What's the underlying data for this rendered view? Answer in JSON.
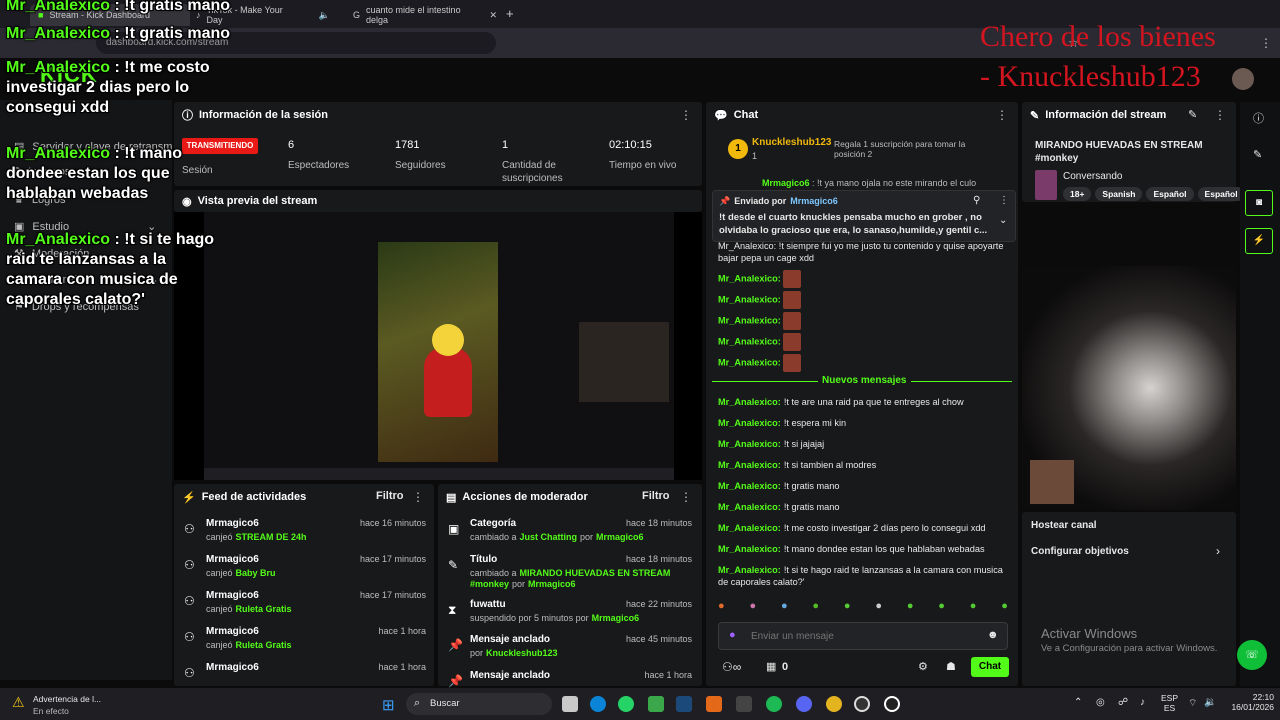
{
  "browser": {
    "tabs": [
      "Stream - Kick Dashboard",
      "TikTok - Make Your Day",
      "cuanto mide el intestino delga"
    ],
    "url": "dashboard.kick.com/stream",
    "new_tab": "+"
  },
  "brand": {
    "logo": "KICK",
    "accent": "#53fc18",
    "live_red": "#e91916"
  },
  "title_overlay": {
    "line1": "Chero de los bienes",
    "line2": "- Knuckleshub123"
  },
  "left_nav": {
    "items": [
      "Servidor y clave de retransm",
      "Ingresos",
      "Logros",
      "Estudio",
      "Moderación",
      "Comunidad",
      "Drops y recompensas"
    ]
  },
  "session": {
    "title": "Información de la sesión",
    "badge": "TRANSMITIENDO",
    "badge_sub": "Sesión",
    "stats": [
      {
        "value": "6",
        "label": "Espectadores"
      },
      {
        "value": "1781",
        "label": "Seguidores"
      },
      {
        "value": "1",
        "label": "Cantidad de suscripciones"
      },
      {
        "value": "02:10:15",
        "label": "Tiempo en vivo"
      }
    ]
  },
  "preview": {
    "title": "Vista previa del stream"
  },
  "feed": {
    "title": "Feed de actividades",
    "filter": "Filtro",
    "rows": [
      {
        "user": "Mrmagico6",
        "action": "canjeó",
        "item": "STREAM DE 24h",
        "time": "hace 16 minutos"
      },
      {
        "user": "Mrmagico6",
        "action": "canjeó",
        "item": "Baby Bru",
        "time": "hace 17 minutos"
      },
      {
        "user": "Mrmagico6",
        "action": "canjeó",
        "item": "Ruleta Gratis",
        "time": "hace 17 minutos"
      },
      {
        "user": "Mrmagico6",
        "action": "canjeó",
        "item": "Ruleta Gratis",
        "time": "hace 1 hora"
      },
      {
        "user": "Mrmagico6",
        "action": "",
        "item": "",
        "time": "hace 1 hora"
      }
    ]
  },
  "mod": {
    "title": "Acciones de moderador",
    "filter": "Filtro",
    "rows": [
      {
        "head": "Categoría",
        "l1": "cambiado a",
        "v1": "Just Chatting",
        "l2": "por",
        "v2": "Mrmagico6",
        "time": "hace 18 minutos"
      },
      {
        "head": "Título",
        "l1": "cambiado a",
        "v1": "MIRANDO HUEVADAS EN STREAM #monkey",
        "l2": "por",
        "v2": "Mrmagico6",
        "time": "hace 18 minutos"
      },
      {
        "head": "fuwattu",
        "l1": "suspendido por 5 minutos por",
        "v1": "Mrmagico6",
        "l2": "",
        "v2": "",
        "time": "hace 22 minutos"
      },
      {
        "head": "Mensaje anclado",
        "l1": "por",
        "v1": "Knuckleshub123",
        "l2": "",
        "v2": "",
        "time": "hace 45 minutos"
      },
      {
        "head": "Mensaje anclado",
        "l1": "",
        "v1": "",
        "l2": "",
        "v2": "",
        "time": "hace 1 hora"
      }
    ]
  },
  "chat": {
    "title": "Chat",
    "top_user": "Knuckleshub123",
    "top_rank": "1",
    "top_count": "1",
    "gift_text": "Regala 1 suscripción para tomar la posición 2",
    "pinned_label": "Enviado por",
    "pinned_user": "Mrmagico6",
    "pinned_text": "!t desde el cuarto knuckles pensaba mucho en grober , no olvidaba lo gracioso que era, lo sanaso,humilde,y gentil c...",
    "partial_user": "Mrmagico6",
    "partial_text": ": !t ya mano ojala no este mirando el culo",
    "partial2_text": "Mr_Analexico: !t siempre fui yo me justo tu contenido y quise apoyarte bajar pepa un cage xdd",
    "emote_user": "Mr_Analexico:",
    "new_messages": "Nuevos mensajes",
    "messages": [
      {
        "user": "Mr_Analexico:",
        "text": "!t te are una raid pa que te entreges al chow"
      },
      {
        "user": "Mr_Analexico:",
        "text": "!t espera mi kin"
      },
      {
        "user": "Mr_Analexico:",
        "text": "!t si jajajaj"
      },
      {
        "user": "Mr_Analexico:",
        "text": "!t si tambien al modres"
      },
      {
        "user": "Mr_Analexico:",
        "text": "!t gratis mano"
      },
      {
        "user": "Mr_Analexico:",
        "text": "!t gratis mano"
      },
      {
        "user": "Mr_Analexico:",
        "text": "!t me costo investigar 2 días pero lo consegui xdd"
      },
      {
        "user": "Mr_Analexico:",
        "text": "!t mano dondee estan los que hablaban webadas"
      },
      {
        "user": "Mr_Analexico:",
        "text": "!t si te hago raid te lanzansas a la camara con musica de caporales calato?'"
      }
    ],
    "input_placeholder": "Enviar un mensaje",
    "points": "0",
    "send": "Chat"
  },
  "stream_info": {
    "title": "Información del stream",
    "stream_title": "MIRANDO HUEVADAS EN STREAM #monkey",
    "category": "Conversando",
    "tags": [
      "18+",
      "Spanish",
      "Español",
      "Español"
    ]
  },
  "actions": {
    "host": "Hostear canal",
    "goals": "Configurar objetivos"
  },
  "watermark": {
    "line1": "Activar Windows",
    "line2": "Ve a Configuración para activar Windows."
  },
  "overlay_chat": [
    {
      "user": "Mr_Analexico",
      "text": " : !t gratis mano"
    },
    {
      "user": "Mr_Analexico",
      "text": " : !t gratis mano"
    },
    {
      "user": "Mr_Analexico",
      "text": " : !t me costo investigar 2 dias pero lo consegui xdd"
    },
    {
      "user": "Mr_Analexico",
      "text": " : !t mano dondee estan los que hablaban webadas"
    },
    {
      "user": "Mr_Analexico",
      "text": " : !t si te hago raid te lanzansas a la camara con musica de caporales calato?'"
    }
  ],
  "taskbar": {
    "warning_title": "Advertencia de l...",
    "warning_sub": "En efecto",
    "search": "Buscar",
    "lang1": "ESP",
    "lang2": "ES",
    "time": "22:10",
    "date": "16/01/2026"
  }
}
